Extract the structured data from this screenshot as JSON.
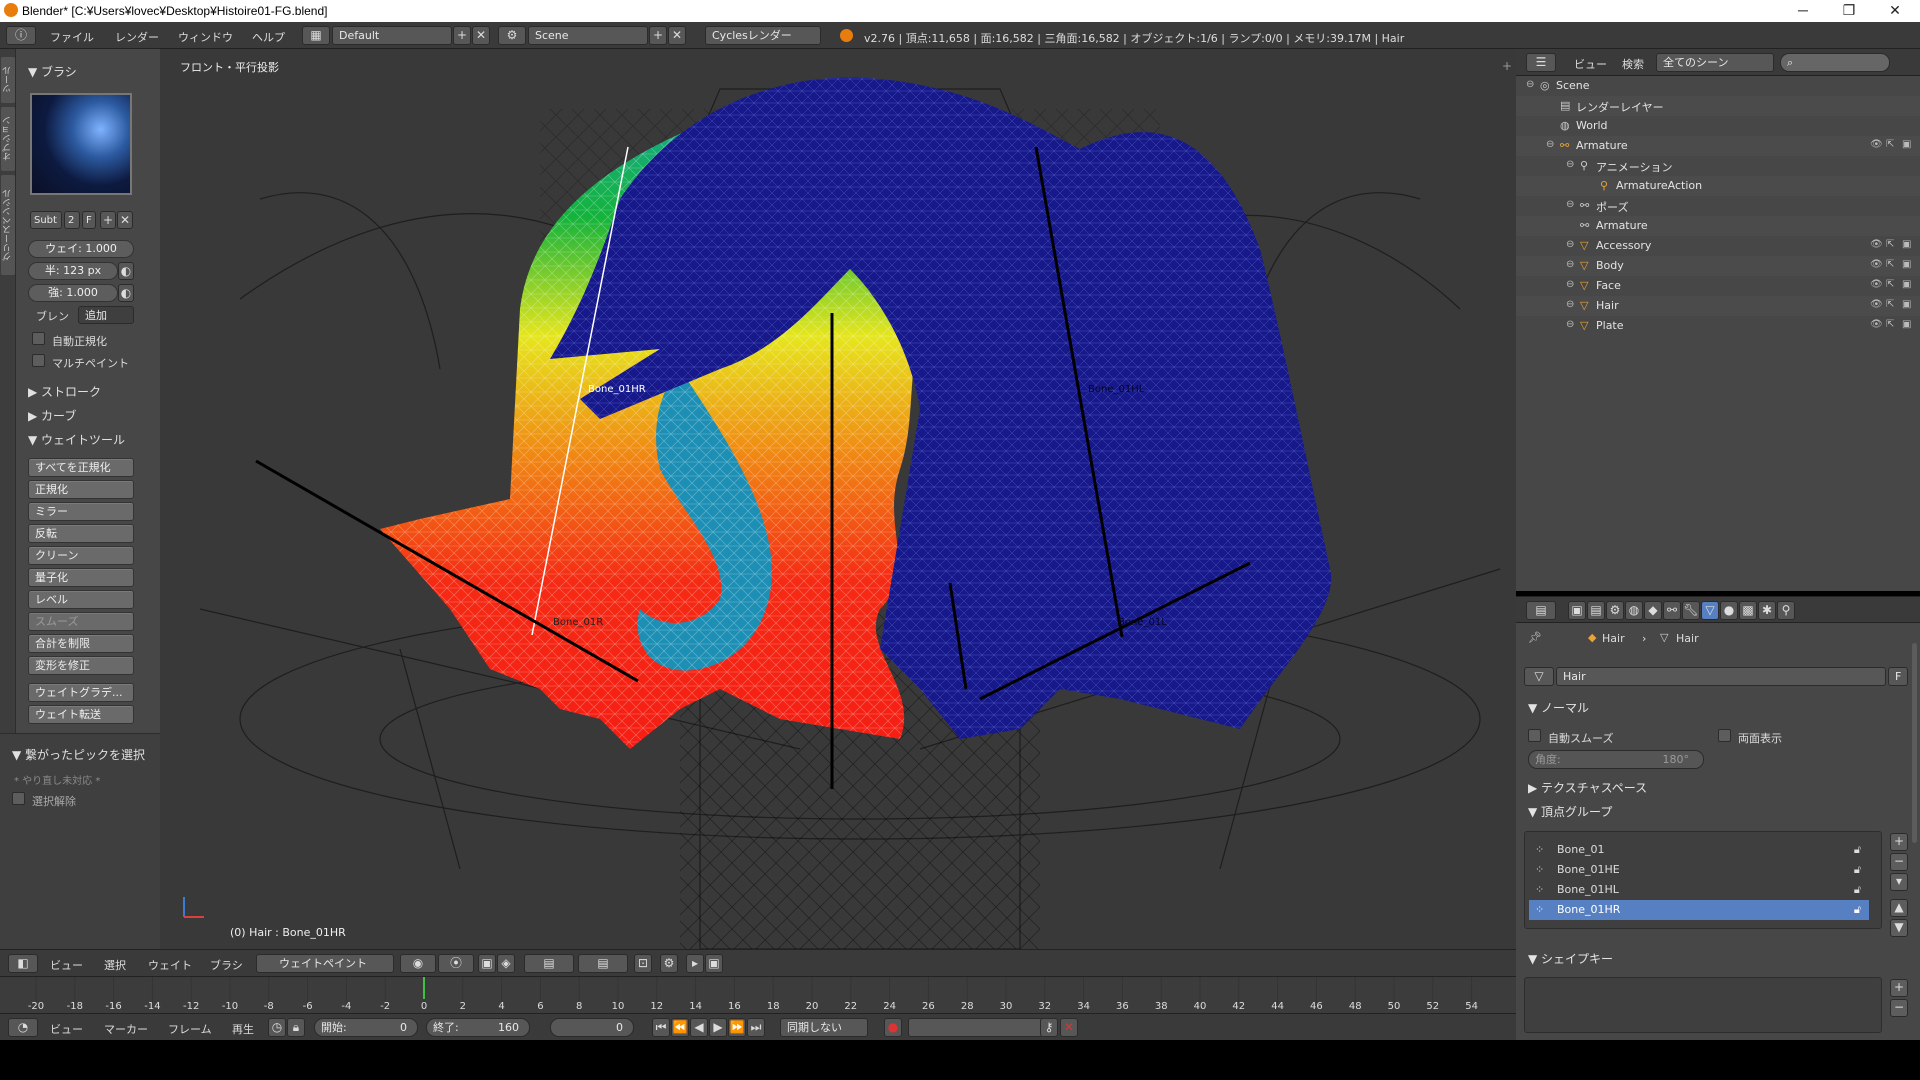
{
  "window": {
    "title": "Blender* [C:¥Users¥lovec¥Desktop¥Histoire01-FG.blend]",
    "minimize": "─",
    "maximize": "❐",
    "close": "✕"
  },
  "info_header": {
    "menus": [
      "ファイル",
      "レンダー",
      "ウィンドウ",
      "ヘルプ"
    ],
    "layout": "Default",
    "scene": "Scene",
    "engine": "Cyclesレンダー",
    "stats": "v2.76 | 頂点:11,658 | 面:16,582 | 三角面:16,582 | オブジェクト:1/6 | ランプ:0/0 | メモリ:39.17M | Hair"
  },
  "tool_shelf": {
    "tabs": [
      "ツール",
      "オプション",
      "グリースペンシル"
    ],
    "brush_header": "ブラシ",
    "brush_name": "Subt",
    "brush_users": "2",
    "brush_fake": "F",
    "weight": "ウェイ:  1.000",
    "radius": "半:  123 px",
    "strength": "強:  1.000",
    "blend_label": "ブレン",
    "blend_value": "追加",
    "auto_normalize": "自動正規化",
    "multi_paint": "マルチペイント",
    "stroke": "ストローク",
    "curve": "カーブ",
    "weight_tools": "ウェイトツール",
    "buttons": [
      "すべてを正規化",
      "正規化",
      "ミラー",
      "反転",
      "クリーン",
      "量子化",
      "レベル",
      "スムーズ",
      "合計を制限",
      "変形を修正",
      "ウェイトグラデ...",
      "ウェイト転送"
    ],
    "operator_panel": "繋がったピックを選択",
    "undo_note": "* やり直し未対応 *",
    "deselect": "選択解除"
  },
  "viewport": {
    "label": "フロント・平行投影",
    "status": "(0) Hair : Bone_01HR",
    "bones": [
      "Bone_01HR",
      "Bone_01R",
      "Bone_01HL",
      "Bone_01L"
    ]
  },
  "viewport_header": {
    "menus": [
      "ビュー",
      "選択",
      "ウェイト",
      "ブラシ"
    ],
    "mode": "ウェイトペイント"
  },
  "timeline": {
    "ticks": [
      "-20",
      "-18",
      "-16",
      "-14",
      "-12",
      "-10",
      "-8",
      "-6",
      "-4",
      "-2",
      "0",
      "2",
      "4",
      "6",
      "8",
      "10",
      "12",
      "14",
      "16",
      "18",
      "20",
      "22",
      "24",
      "26",
      "28",
      "30",
      "32",
      "34",
      "36",
      "38",
      "40",
      "42",
      "44",
      "46",
      "48",
      "50",
      "52",
      "54"
    ],
    "current_frame": 0,
    "menus": [
      "ビュー",
      "マーカー",
      "フレーム",
      "再生"
    ],
    "start_label": "開始:",
    "start": "0",
    "end_label": "終了:",
    "end": "160",
    "frame": "0",
    "sync": "同期しない"
  },
  "outliner": {
    "menus": [
      "ビュー",
      "検索"
    ],
    "filter": "全てのシーン",
    "items": [
      {
        "name": "Scene",
        "indent": 0
      },
      {
        "name": "レンダーレイヤー",
        "indent": 1
      },
      {
        "name": "World",
        "indent": 1
      },
      {
        "name": "Armature",
        "indent": 1
      },
      {
        "name": "アニメーション",
        "indent": 2
      },
      {
        "name": "ArmatureAction",
        "indent": 3
      },
      {
        "name": "ポーズ",
        "indent": 2
      },
      {
        "name": "Armature",
        "indent": 2
      },
      {
        "name": "Accessory",
        "indent": 2
      },
      {
        "name": "Body",
        "indent": 2
      },
      {
        "name": "Face",
        "indent": 2
      },
      {
        "name": "Hair",
        "indent": 2
      },
      {
        "name": "Plate",
        "indent": 2
      }
    ]
  },
  "properties": {
    "breadcrumb_obj": "Hair",
    "breadcrumb_mesh": "Hair",
    "mesh_name": "Hair",
    "fake": "F",
    "normals": "ノーマル",
    "auto_smooth": "自動スムーズ",
    "double_sided": "両面表示",
    "angle_label": "角度:",
    "angle": "180°",
    "texture_space": "テクスチャスペース",
    "vertex_groups": "頂点グループ",
    "groups": [
      "Bone_01",
      "Bone_01HE",
      "Bone_01HL",
      "Bone_01HR"
    ],
    "selected_group": 3,
    "shape_keys": "シェイプキー"
  },
  "colors": {
    "accent": "#5680c2",
    "weight_zero": "#1a1f8c"
  }
}
